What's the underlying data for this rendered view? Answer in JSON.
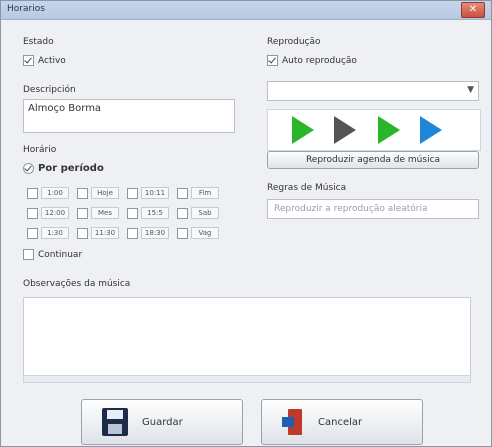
{
  "window": {
    "title": "Horarios"
  },
  "left": {
    "status_group": "Estado",
    "active_label": "Activo",
    "description_label": "Descripción",
    "description_value": "Almoço Borma",
    "times_label": "Horário",
    "per_hour_label": "Por período",
    "grid_labels": [
      "1:00",
      "Hoje",
      "10:11",
      "Fim",
      "12:00",
      "Mes",
      "15:5",
      "Sab",
      "1:30",
      "11:30",
      "18:30",
      "Vag"
    ],
    "continue_label": "Continuar"
  },
  "right": {
    "station_group": "Reprodução",
    "auto_label": "Auto reprodução",
    "select_label": "",
    "play_label": "Reproduzir agenda de música",
    "rule_label": "Regras de Música",
    "rule_option": "Reproduzir a reprodução aleatória"
  },
  "bottom": {
    "observations_label": "Observações da música",
    "save_button": "Guardar",
    "exit_button": "Cancelar"
  },
  "colors": {
    "title_bg": "#b7c9e2",
    "play_green": "#2bb52b",
    "play_gray": "#555555",
    "play_blue": "#1f86d8"
  }
}
